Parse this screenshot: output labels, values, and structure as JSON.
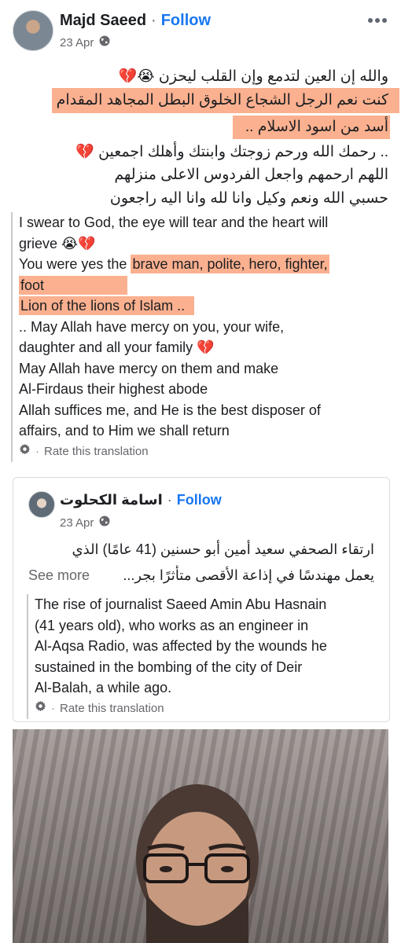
{
  "post": {
    "author": "Majd Saeed",
    "separator": "·",
    "follow": "Follow",
    "date": "23 Apr",
    "arabic_lines": [
      "والله إن العين لتدمع وإن القلب ليحزن 😭💔",
      "كنت نعم الرجل الشجاع الخلوق البطل المجاهد المقدام",
      "أسد من اسود الاسلام ..",
      ".. رحمك الله ورحم زوجتك وابنتك وأهلك اجمعين 💔",
      "اللهم ارحمهم واجعل الفردوس الاعلى منزلهم",
      "حسبي الله ونعم وكيل وانا لله وانا اليه راجعون"
    ],
    "translation": {
      "line1": "I swear to God, the eye will tear and the heart will",
      "line2": "grieve 😭💔",
      "line3_pre": "You were yes the ",
      "line3_hl": "brave man, polite, hero, fighter,",
      "line4_hl": "foot",
      "line5_hl": "Lion of the lions of Islam ..",
      "line6": ".. May Allah have mercy on you, your wife,",
      "line7": "daughter and all your family 💔",
      "line8": "May Allah have mercy on them and make",
      "line9": "Al-Firdaus their highest abode",
      "line10": "Allah suffices me, and He is the best disposer of",
      "line11": "affairs, and to Him we shall return"
    },
    "rate_translation": "Rate this translation"
  },
  "shared": {
    "author": "اسامة الكحلوت",
    "follow": "Follow",
    "date": "23 Apr",
    "arabic_line1": "ارتقاء الصحفي سعيد أمين أبو حسنين (41 عامًا) الذي",
    "arabic_line2": "يعمل مهندسًا في إذاعة الأقصى متأثرًا بجر...",
    "see_more": "See more",
    "translation_lines": [
      "The rise of journalist Saeed Amin Abu Hasnain",
      "(41 years old), who works as an engineer in",
      "Al-Aqsa Radio, was affected by the wounds he",
      "sustained in the bombing of the city of Deir",
      "Al-Balah, a while ago."
    ],
    "rate_translation": "Rate this translation"
  },
  "colors": {
    "highlight": "#fbb08f",
    "link": "#1877f2",
    "muted": "#65676b"
  },
  "icons": [
    "globe-icon",
    "more-icon",
    "gear-icon"
  ]
}
